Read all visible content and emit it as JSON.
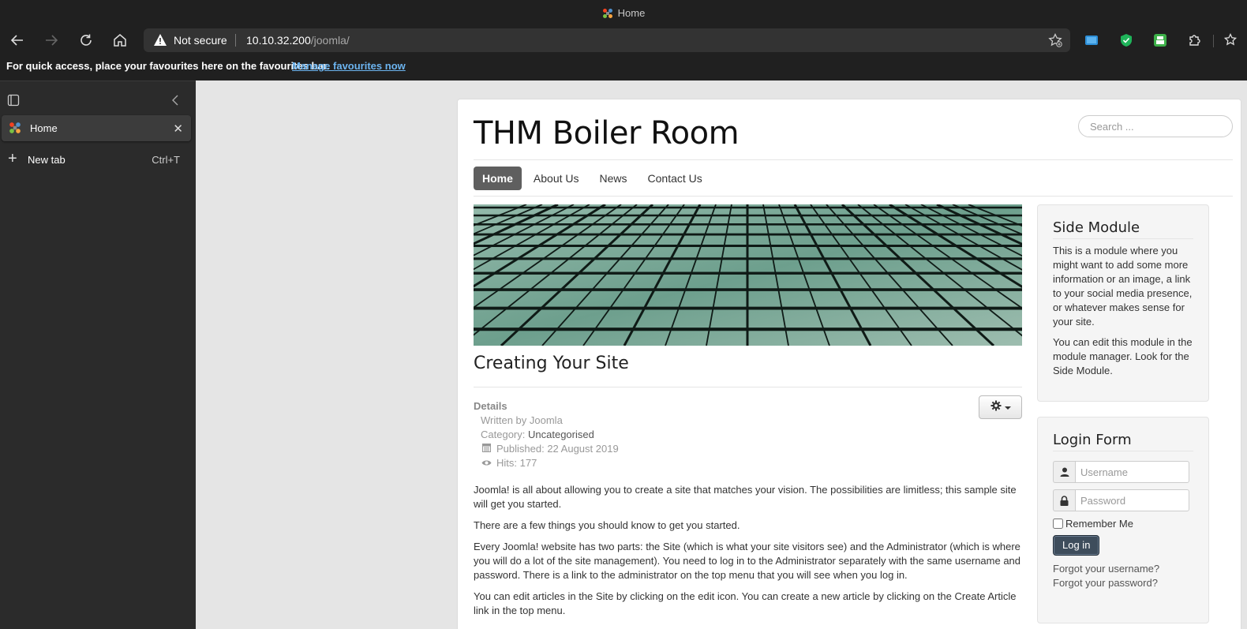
{
  "window": {
    "title": "Home"
  },
  "toolbar": {
    "security_label": "Not secure",
    "url_host": "10.10.32.200",
    "url_path": "/joomla/"
  },
  "favbar": {
    "message": "For quick access, place your favourites here on the favourites bar.",
    "link": "Manage favourites now"
  },
  "sidebar": {
    "active_tab": "Home",
    "new_tab_label": "New tab",
    "new_tab_shortcut": "Ctrl+T"
  },
  "site": {
    "brand": "THM Boiler Room",
    "search_placeholder": "Search ...",
    "nav": [
      "Home",
      "About Us",
      "News",
      "Contact Us"
    ],
    "active_nav": "Home"
  },
  "article": {
    "title": "Creating Your Site",
    "details_heading": "Details",
    "written_by": "Written by Joomla",
    "category_label": "Category:",
    "category": "Uncategorised",
    "published": "Published: 22 August 2019",
    "hits": "Hits: 177",
    "paragraphs": [
      "Joomla! is all about allowing you to create a site that matches your vision. The possibilities are limitless; this sample site will get you started.",
      "There are a few things you should know to get you started.",
      "Every Joomla! website has two parts: the Site (which is what your site visitors see) and the Administrator (which is where you will do a lot of the site management). You need to log in to the Administrator separately with the same username and password. There is a link to the administrator on the top menu that you will see when you log in.",
      "You can edit articles in the Site by clicking on the edit icon. You can create a new article by clicking on the Create Article link in the top menu."
    ]
  },
  "side_module": {
    "title": "Side Module",
    "p1": "This is a module where you might want to add some more information or an image, a link to your social media presence, or whatever makes sense for your site.",
    "p2": "You can edit this module in the module manager. Look for the Side Module."
  },
  "login": {
    "title": "Login Form",
    "username_placeholder": "Username",
    "password_placeholder": "Password",
    "remember": "Remember Me",
    "button": "Log in",
    "forgot_username": "Forgot your username?",
    "forgot_password": "Forgot your password?"
  },
  "colors": {
    "chrome_bg": "#202020",
    "sidebar_bg": "#2b2b2b",
    "nav_active": "#5f5f5f",
    "login_button": "#3e4d5c",
    "link_blue": "#6cb4f0"
  },
  "icons": [
    "back-icon",
    "forward-icon",
    "refresh-icon",
    "home-icon",
    "warning-icon",
    "favourite-add-icon",
    "extension-icon",
    "shield-icon",
    "printer-icon",
    "puzzle-icon",
    "favourites-icon",
    "tab-actions-icon",
    "collapse-icon",
    "close-icon",
    "plus-icon",
    "gear-icon",
    "calendar-icon",
    "eye-icon",
    "user-icon",
    "lock-icon"
  ]
}
